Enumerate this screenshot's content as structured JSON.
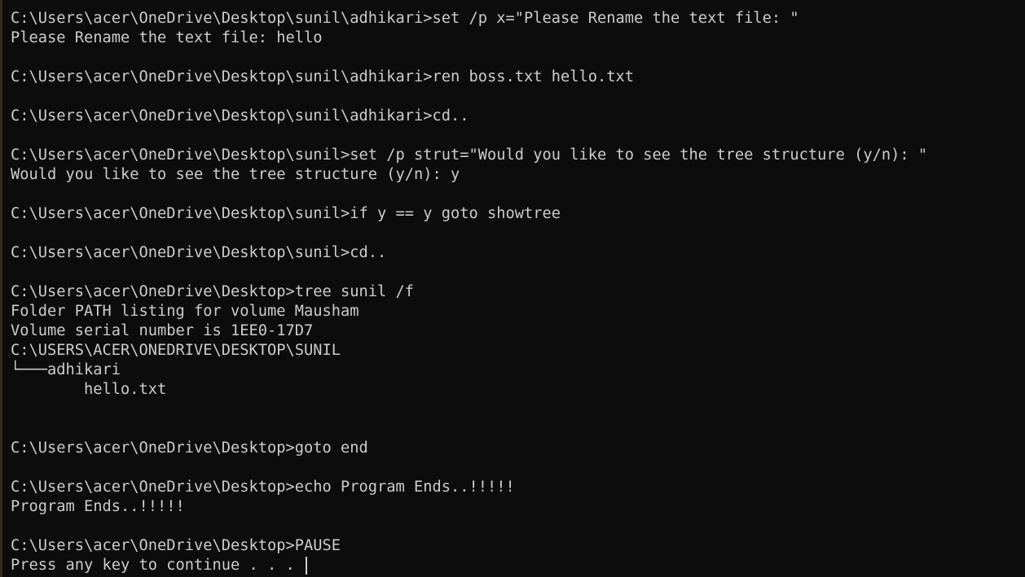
{
  "terminal": {
    "lines": [
      "C:\\Users\\acer\\OneDrive\\Desktop\\sunil\\adhikari>set /p x=\"Please Rename the text file: \"",
      "Please Rename the text file: hello",
      "",
      "C:\\Users\\acer\\OneDrive\\Desktop\\sunil\\adhikari>ren boss.txt hello.txt",
      "",
      "C:\\Users\\acer\\OneDrive\\Desktop\\sunil\\adhikari>cd..",
      "",
      "C:\\Users\\acer\\OneDrive\\Desktop\\sunil>set /p strut=\"Would you like to see the tree structure (y/n): \"",
      "Would you like to see the tree structure (y/n): y",
      "",
      "C:\\Users\\acer\\OneDrive\\Desktop\\sunil>if y == y goto showtree",
      "",
      "C:\\Users\\acer\\OneDrive\\Desktop\\sunil>cd..",
      "",
      "C:\\Users\\acer\\OneDrive\\Desktop>tree sunil /f",
      "Folder PATH listing for volume Mausham",
      "Volume serial number is 1EE0-17D7",
      "C:\\USERS\\ACER\\ONEDRIVE\\DESKTOP\\SUNIL",
      "└───adhikari",
      "        hello.txt",
      "",
      "",
      "C:\\Users\\acer\\OneDrive\\Desktop>goto end",
      "",
      "C:\\Users\\acer\\OneDrive\\Desktop>echo Program Ends..!!!!!",
      "Program Ends..!!!!!",
      "",
      "C:\\Users\\acer\\OneDrive\\Desktop>PAUSE",
      "Press any key to continue . . . "
    ]
  },
  "colors": {
    "background": "#0c0c0c",
    "foreground": "#cccccc"
  }
}
